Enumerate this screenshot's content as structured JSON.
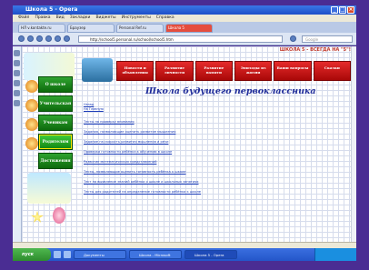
{
  "window": {
    "title": "Школа 5 - Opera"
  },
  "menu": {
    "items": [
      "Файл",
      "Правка",
      "Вид",
      "Закладки",
      "Виджеты",
      "Инструменты",
      "Справка"
    ]
  },
  "tabs": [
    {
      "label": "НЛ v.kontakte.ru"
    },
    {
      "label": "Браузер"
    },
    {
      "label": "Personal Ref.ru"
    },
    {
      "label": "Школа 5"
    }
  ],
  "address": {
    "url": "http://school5.personal.ru/school/school5.htm"
  },
  "search": {
    "placeholder": "Google"
  },
  "site": {
    "motto": "ШКОЛА 5 - ВСЕГДА НА \"5\"!",
    "heading": "Школа будущего первоклассника",
    "top_nav": [
      "Новости и объявления",
      "Развитие личности",
      "Развитие памяти",
      "Эпизоды из жизни",
      "Ваши вопросы",
      "Сказки"
    ],
    "side_menu": [
      "О школе",
      "Учительская",
      "Ученикам",
      "Родителям",
      "Достижения"
    ],
    "back_links": [
      "Назад",
      "На Главную"
    ],
    "links": [
      "Тесты на проверку внимания",
      "Задания, позволяющие оценить развитие мышления",
      "Задание на скорость развития мышления и речи",
      "Проверка готовности ребёнка к обучению в школе",
      "Развитие математических представлений",
      "Тесты, позволяющие оценить готовность ребёнка к школе",
      "Тест на выявление знаний ребёнка о школе и школьных занятиях",
      "Тесты для родителей на определение готовности ребёнка к школе"
    ]
  },
  "statusbar": {
    "text": ""
  },
  "taskbar": {
    "start": "пуск",
    "tasks": [
      "Документы",
      "Школа - Microsoft",
      "Школа 5 - Opera"
    ],
    "clock": ""
  }
}
